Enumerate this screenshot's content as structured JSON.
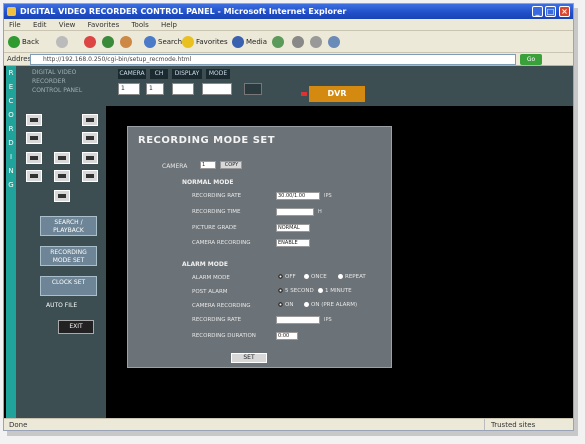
{
  "window": {
    "title": "DIGITAL VIDEO RECORDER CONTROL PANEL - Microsoft Internet Explorer"
  },
  "menu": [
    "File",
    "Edit",
    "View",
    "Favorites",
    "Tools",
    "Help"
  ],
  "toolbar": {
    "back": "Back",
    "search": "Search",
    "favorites": "Favorites",
    "media": "Media"
  },
  "address": {
    "label": "Address",
    "url": "http://192.168.0.250/cgi-bin/setup_recmode.html",
    "go": "Go"
  },
  "sidebar": {
    "strip_letters": "RECORDING",
    "logo_lines": [
      "DIGITAL VIDEO",
      "RECORDER",
      "CONTROL PANEL"
    ],
    "buttons": [
      {
        "label": "SEARCH / PLAYBACK"
      },
      {
        "label": "RECORDING MODE SET"
      },
      {
        "label": "CLOCK SET"
      }
    ],
    "autofile": "AUTO  FILE",
    "small_button": "EXIT"
  },
  "topctl": {
    "labels": [
      "CAMERA",
      "CH",
      "DISPLAY",
      "MODE"
    ],
    "values": [
      "1",
      "1",
      "",
      ""
    ],
    "brand": "DVR"
  },
  "dialog": {
    "title": "RECORDING MODE SET",
    "camera_label": "CAMERA",
    "camera_value": "1",
    "camera_btn": "COPY",
    "normal_section": "NORMAL MODE",
    "normal": [
      {
        "label": "RECORDING RATE",
        "value": "30.00/1.00",
        "unit": "IPS"
      },
      {
        "label": "RECORDING TIME",
        "value": "",
        "unit": "H"
      },
      {
        "label": "PICTURE GRADE",
        "value": "NORMAL"
      },
      {
        "label": "CAMERA RECORDING",
        "value": "ENABLE"
      }
    ],
    "alarm_section": "ALARM MODE",
    "alarm": {
      "mode_label": "ALARM MODE",
      "mode_opts": [
        "OFF",
        "ONCE",
        "REPEAT"
      ],
      "post_label": "POST ALARM",
      "post_opts": [
        "5 SECOND",
        "1 MINUTE"
      ],
      "cam_label": "CAMERA RECORDING",
      "cam_opts": [
        "ON",
        "ON (PRE ALARM)"
      ],
      "rate_label": "RECORDING RATE",
      "rate_value": "",
      "rate_unit": "IPS",
      "dur_label": "RECORDING DURATION",
      "dur_value": "0:00"
    },
    "set_button": "SET"
  },
  "status": {
    "left": "Done",
    "right": "Trusted sites"
  }
}
